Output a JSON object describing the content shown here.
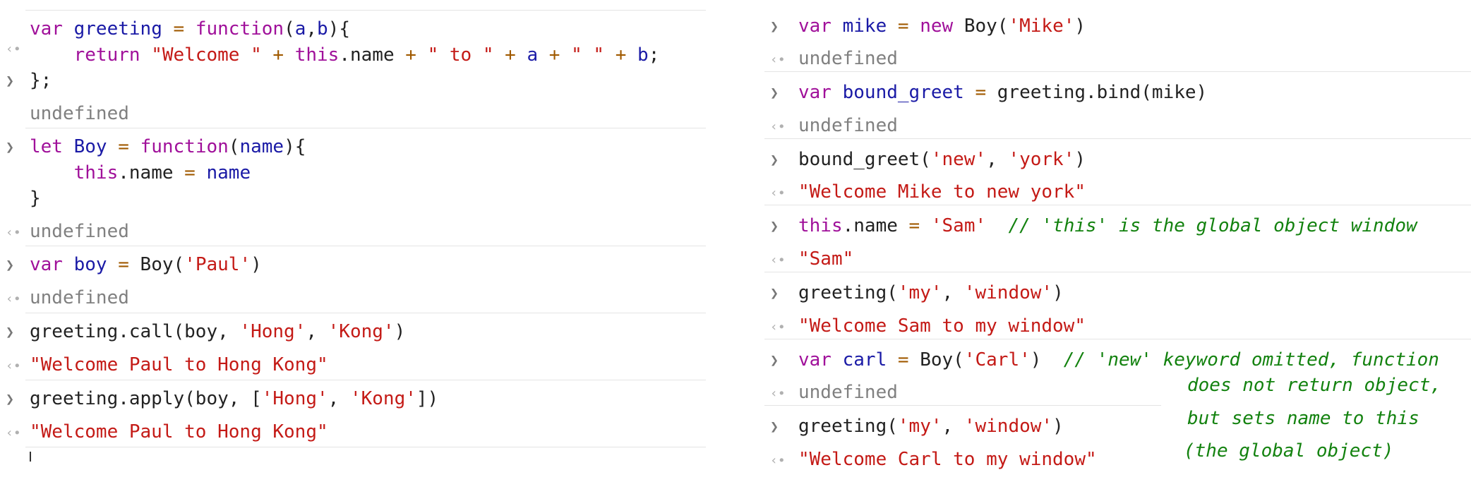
{
  "left": {
    "entries": [
      {
        "input_lines": [
          [
            {
              "t": "var",
              "c": "k"
            },
            {
              "t": " "
            },
            {
              "t": "greeting",
              "c": "v"
            },
            {
              "t": " "
            },
            {
              "t": "=",
              "c": "o"
            },
            {
              "t": " "
            },
            {
              "t": "function",
              "c": "k"
            },
            {
              "t": "("
            },
            {
              "t": "a",
              "c": "v"
            },
            {
              "t": ","
            },
            {
              "t": "b",
              "c": "v"
            },
            {
              "t": "){"
            }
          ],
          [
            {
              "t": "    "
            },
            {
              "t": "return",
              "c": "k"
            },
            {
              "t": " "
            },
            {
              "t": "\"Welcome \"",
              "c": "s"
            },
            {
              "t": " "
            },
            {
              "t": "+",
              "c": "o"
            },
            {
              "t": " "
            },
            {
              "t": "this",
              "c": "k"
            },
            {
              "t": ".name "
            },
            {
              "t": "+",
              "c": "o"
            },
            {
              "t": " "
            },
            {
              "t": "\" to \"",
              "c": "s"
            },
            {
              "t": " "
            },
            {
              "t": "+",
              "c": "o"
            },
            {
              "t": " "
            },
            {
              "t": "a",
              "c": "v"
            },
            {
              "t": " "
            },
            {
              "t": "+",
              "c": "o"
            },
            {
              "t": " "
            },
            {
              "t": "\" \"",
              "c": "s"
            },
            {
              "t": " "
            },
            {
              "t": "+",
              "c": "o"
            },
            {
              "t": " "
            },
            {
              "t": "b",
              "c": "v"
            },
            {
              "t": ";"
            }
          ],
          [
            {
              "t": "};"
            }
          ]
        ],
        "output": "undefined",
        "output_type": "undefined"
      },
      {
        "input_lines": [
          [
            {
              "t": "let",
              "c": "k"
            },
            {
              "t": " "
            },
            {
              "t": "Boy",
              "c": "v"
            },
            {
              "t": " "
            },
            {
              "t": "=",
              "c": "o"
            },
            {
              "t": " "
            },
            {
              "t": "function",
              "c": "k"
            },
            {
              "t": "("
            },
            {
              "t": "name",
              "c": "v"
            },
            {
              "t": "){"
            }
          ],
          [
            {
              "t": "    "
            },
            {
              "t": "this",
              "c": "k"
            },
            {
              "t": ".name "
            },
            {
              "t": "=",
              "c": "o"
            },
            {
              "t": " "
            },
            {
              "t": "name",
              "c": "v"
            }
          ],
          [
            {
              "t": "}"
            }
          ]
        ],
        "output": "undefined",
        "output_type": "undefined"
      },
      {
        "input_lines": [
          [
            {
              "t": "var",
              "c": "k"
            },
            {
              "t": " "
            },
            {
              "t": "boy",
              "c": "v"
            },
            {
              "t": " "
            },
            {
              "t": "=",
              "c": "o"
            },
            {
              "t": " Boy("
            },
            {
              "t": "'Paul'",
              "c": "s"
            },
            {
              "t": ")"
            }
          ]
        ],
        "output": "undefined",
        "output_type": "undefined"
      },
      {
        "input_lines": [
          [
            {
              "t": "greeting.call(boy, "
            },
            {
              "t": "'Hong'",
              "c": "s"
            },
            {
              "t": ", "
            },
            {
              "t": "'Kong'",
              "c": "s"
            },
            {
              "t": ")"
            }
          ]
        ],
        "output": "\"Welcome Paul to Hong Kong\"",
        "output_type": "string"
      },
      {
        "input_lines": [
          [
            {
              "t": "greeting.apply(boy, ["
            },
            {
              "t": "'Hong'",
              "c": "s"
            },
            {
              "t": ", "
            },
            {
              "t": "'Kong'",
              "c": "s"
            },
            {
              "t": "])"
            }
          ]
        ],
        "output": "\"Welcome Paul to Hong Kong\"",
        "output_type": "string"
      }
    ]
  },
  "right": {
    "entries": [
      {
        "input": [
          {
            "t": "var",
            "c": "k"
          },
          {
            "t": " "
          },
          {
            "t": "mike",
            "c": "v"
          },
          {
            "t": " "
          },
          {
            "t": "=",
            "c": "o"
          },
          {
            "t": " "
          },
          {
            "t": "new",
            "c": "k"
          },
          {
            "t": " Boy("
          },
          {
            "t": "'Mike'",
            "c": "s"
          },
          {
            "t": ")"
          }
        ],
        "output": "undefined",
        "output_type": "undefined"
      },
      {
        "input": [
          {
            "t": "var",
            "c": "k"
          },
          {
            "t": " "
          },
          {
            "t": "bound_greet",
            "c": "v"
          },
          {
            "t": " "
          },
          {
            "t": "=",
            "c": "o"
          },
          {
            "t": " greeting.bind(mike)"
          }
        ],
        "output": "undefined",
        "output_type": "undefined"
      },
      {
        "input": [
          {
            "t": "bound_greet("
          },
          {
            "t": "'new'",
            "c": "s"
          },
          {
            "t": ", "
          },
          {
            "t": "'york'",
            "c": "s"
          },
          {
            "t": ")"
          }
        ],
        "output": "\"Welcome Mike to new york\"",
        "output_type": "string"
      },
      {
        "input": [
          {
            "t": "this",
            "c": "k"
          },
          {
            "t": ".name "
          },
          {
            "t": "=",
            "c": "o"
          },
          {
            "t": " "
          },
          {
            "t": "'Sam'",
            "c": "s"
          },
          {
            "t": "  "
          },
          {
            "t": "// 'this' is the global object window",
            "c": "c"
          }
        ],
        "output": "\"Sam\"",
        "output_type": "string"
      },
      {
        "input": [
          {
            "t": "greeting("
          },
          {
            "t": "'my'",
            "c": "s"
          },
          {
            "t": ", "
          },
          {
            "t": "'window'",
            "c": "s"
          },
          {
            "t": ")"
          }
        ],
        "output": "\"Welcome Sam to my window\"",
        "output_type": "string"
      },
      {
        "input": [
          {
            "t": "var",
            "c": "k"
          },
          {
            "t": " "
          },
          {
            "t": "carl",
            "c": "v"
          },
          {
            "t": " "
          },
          {
            "t": "=",
            "c": "o"
          },
          {
            "t": " Boy("
          },
          {
            "t": "'Carl'",
            "c": "s"
          },
          {
            "t": ")  "
          },
          {
            "t": "// 'new' keyword omitted, function",
            "c": "c"
          }
        ],
        "output": "undefined",
        "output_type": "undefined"
      },
      {
        "input": [
          {
            "t": "greeting("
          },
          {
            "t": "'my'",
            "c": "s"
          },
          {
            "t": ", "
          },
          {
            "t": "'window'",
            "c": "s"
          },
          {
            "t": ")"
          }
        ],
        "output": "\"Welcome Carl to my window\"",
        "output_type": "string"
      }
    ],
    "annotation_lines": [
      "does not return object,",
      "but sets name to this",
      "(the global object)"
    ]
  }
}
